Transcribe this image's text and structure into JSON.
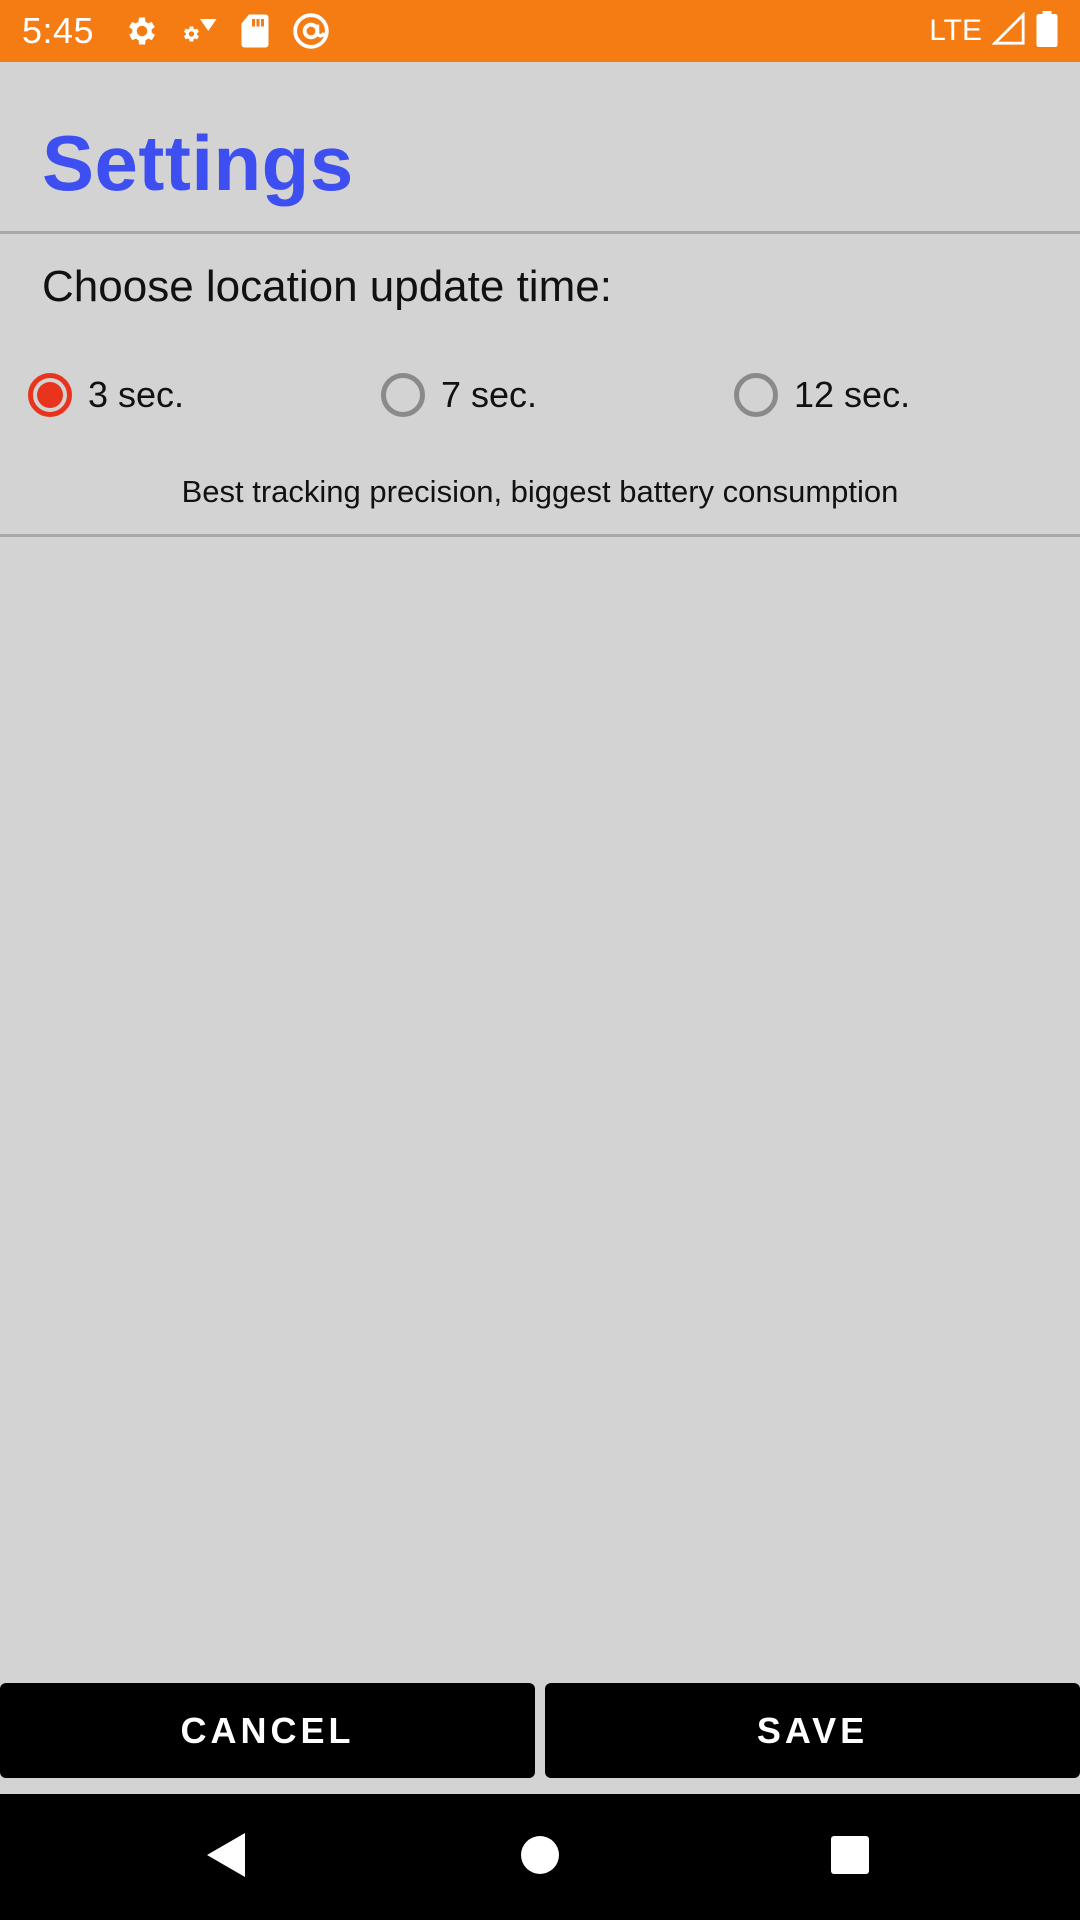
{
  "status_bar": {
    "time": "5:45",
    "network": "LTE",
    "background_color": "#f57c13",
    "icons_left": [
      "settings-gear-icon",
      "small-gear-wifi-icon",
      "sd-card-icon",
      "blocked-at-icon"
    ],
    "icons_right": [
      "signal-icon",
      "battery-icon"
    ]
  },
  "header": {
    "title": "Settings",
    "title_color": "#3d4ff0"
  },
  "settings": {
    "prompt": "Choose location update time:",
    "options": [
      {
        "label": "3 sec.",
        "checked": true
      },
      {
        "label": "7 sec.",
        "checked": false
      },
      {
        "label": "12 sec.",
        "checked": false
      }
    ],
    "description": "Best tracking precision, biggest battery consumption",
    "accent_color": "#e8341c"
  },
  "actions": {
    "cancel_label": "CANCEL",
    "save_label": "SAVE"
  },
  "nav_bar": {
    "icons": [
      "back-icon",
      "home-icon",
      "recents-icon"
    ]
  }
}
